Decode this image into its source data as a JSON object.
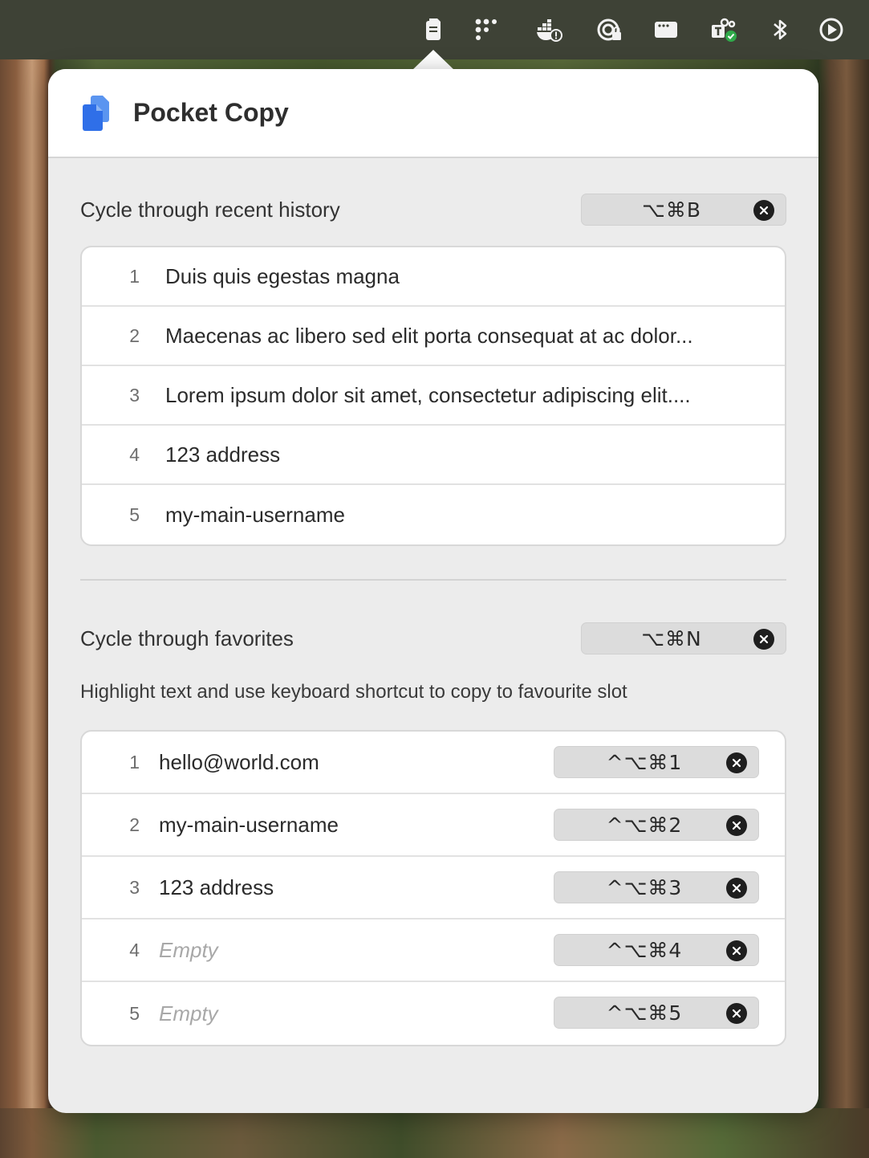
{
  "menubar": {
    "icons": [
      {
        "name": "clipboard-icon"
      },
      {
        "name": "dots-grid-icon"
      },
      {
        "name": "docker-alert-icon"
      },
      {
        "name": "vpn-lock-icon"
      },
      {
        "name": "window-icon"
      },
      {
        "name": "teams-icon"
      },
      {
        "name": "bluetooth-icon"
      },
      {
        "name": "play-circle-icon"
      }
    ]
  },
  "app": {
    "title": "Pocket Copy",
    "brand_color": "#2f6fe8"
  },
  "history": {
    "label": "Cycle through recent history",
    "shortcut": "⌥⌘B",
    "items": [
      {
        "num": "1",
        "text": "Duis quis egestas magna"
      },
      {
        "num": "2",
        "text": "Maecenas ac libero sed elit porta consequat at ac dolor..."
      },
      {
        "num": "3",
        "text": "Lorem ipsum dolor sit amet, consectetur adipiscing elit...."
      },
      {
        "num": "4",
        "text": "123 address"
      },
      {
        "num": "5",
        "text": "my-main-username"
      }
    ]
  },
  "favorites": {
    "label": "Cycle through favorites",
    "shortcut": "⌥⌘N",
    "hint": "Highlight text and use keyboard shortcut to copy to favourite slot",
    "items": [
      {
        "num": "1",
        "text": "hello@world.com",
        "shortcut": "^⌥⌘1"
      },
      {
        "num": "2",
        "text": "my-main-username",
        "shortcut": "^⌥⌘2"
      },
      {
        "num": "3",
        "text": "123 address",
        "shortcut": "^⌥⌘3"
      },
      {
        "num": "4",
        "text": "Empty",
        "shortcut": "^⌥⌘4"
      },
      {
        "num": "5",
        "text": "Empty",
        "shortcut": "^⌥⌘5"
      }
    ]
  }
}
